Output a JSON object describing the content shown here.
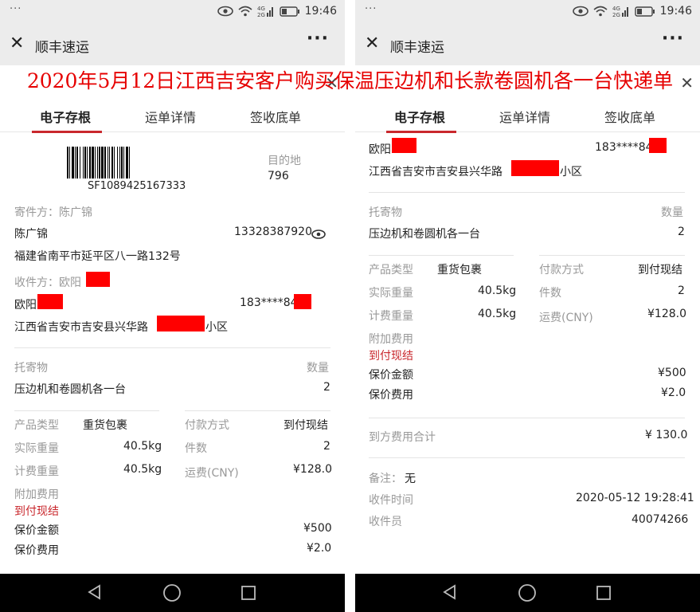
{
  "status": {
    "dots": "···",
    "time": "19:46",
    "network": "4G 2G"
  },
  "app": {
    "title": "顺丰速运"
  },
  "overlay": {
    "title": "2020年5月12日江西吉安客户购买保温压边机和长款卷圆机各一台快递单"
  },
  "tabs": [
    {
      "label": "电子存根",
      "active": true
    },
    {
      "label": "运单详情",
      "active": false
    },
    {
      "label": "签收底单",
      "active": false
    }
  ],
  "waybill": {
    "barcode_number": "SF1089425167333",
    "destination_label": "目的地",
    "destination_code": "796"
  },
  "sender": {
    "label": "寄件方：陈广锦",
    "name": "陈广锦",
    "phone": "13328387920",
    "address": "福建省南平市延平区八一路132号"
  },
  "receiver": {
    "label": "收件方：欧阳",
    "name": "欧阳",
    "phone": "183****84",
    "address_prefix": "江西省吉安市吉安县兴华路",
    "address_suffix": "小区"
  },
  "consignment": {
    "label": "托寄物",
    "qty_label": "数量",
    "item": "压边机和卷圆机各一台",
    "qty": "2"
  },
  "details": {
    "product_type_label": "产品类型",
    "product_type": "重货包裹",
    "actual_weight_label": "实际重量",
    "actual_weight": "40.5kg",
    "billed_weight_label": "计费重量",
    "billed_weight": "40.5kg",
    "payment_label": "付款方式",
    "payment": "到付现结",
    "pieces_label": "件数",
    "pieces": "2",
    "freight_label": "运费(CNY)",
    "freight": "¥128.0",
    "extra_fee_label": "附加费用",
    "extra_fee_value": "到付现结",
    "insured_amount_label": "保价金额",
    "insured_amount": "¥500",
    "insurance_fee_label": "保价费用",
    "insurance_fee": "¥2.0"
  },
  "totals": {
    "total_label": "到方费用合计",
    "total": "¥ 130.0",
    "remark_label": "备注：",
    "remark": "无",
    "received_time_label": "收件时间",
    "received_time": "2020-05-12 19:28:41",
    "courier_label": "收件员",
    "courier": "40074266"
  },
  "colors": {
    "accent": "#c9282d",
    "redaction": "#ff0000",
    "header_bg": "#ececec",
    "overlay_text": "#e60000"
  }
}
